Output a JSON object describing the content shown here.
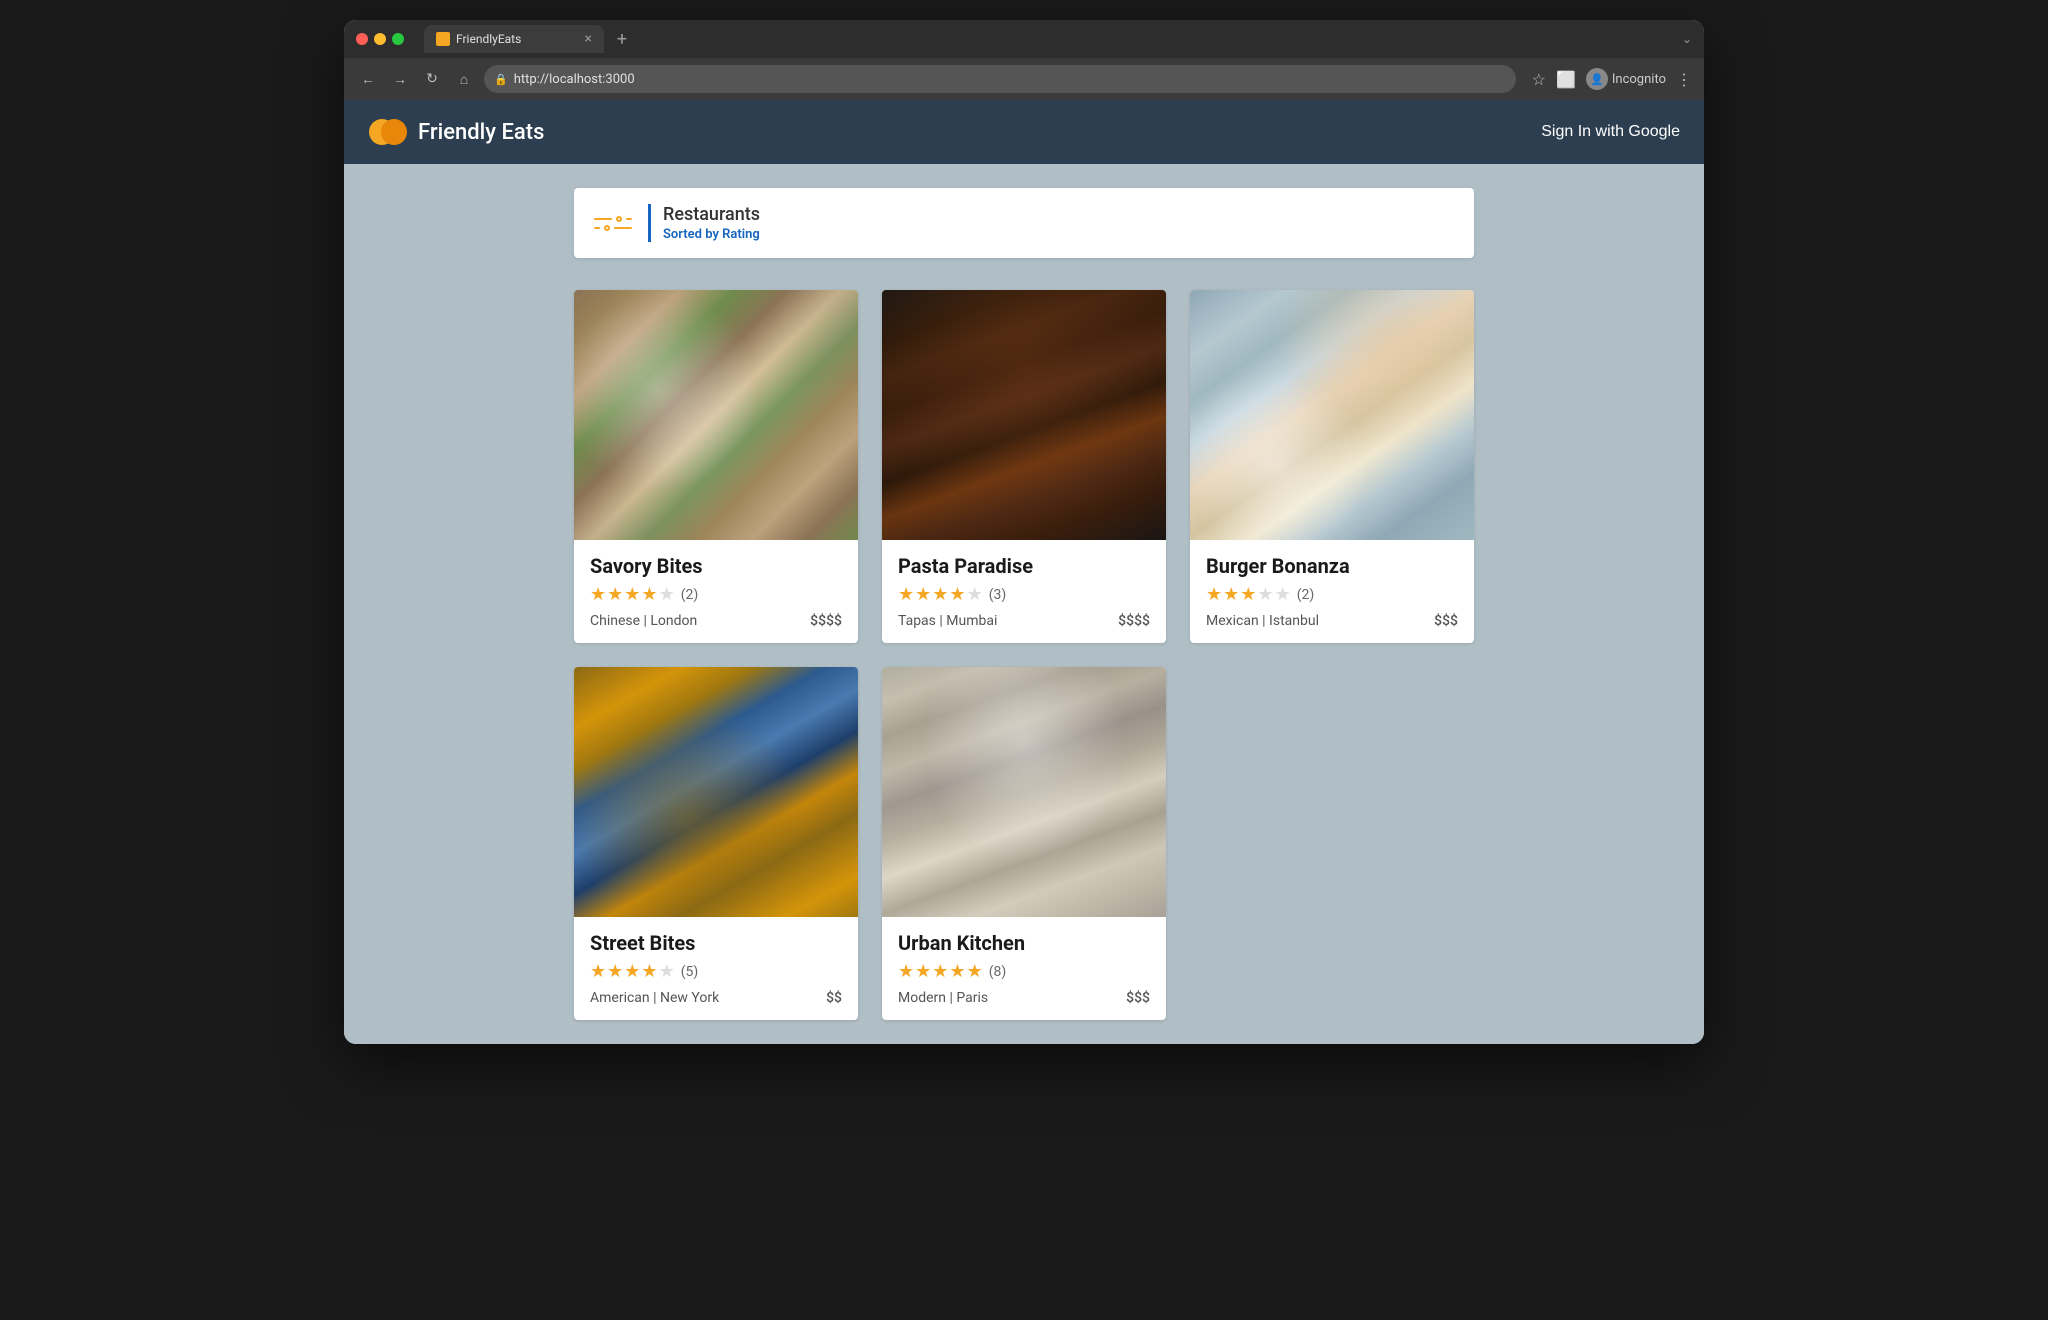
{
  "browser": {
    "tab_title": "FriendlyEats",
    "url": "http://localhost:3000",
    "incognito_label": "Incognito",
    "new_tab_symbol": "+",
    "chevron": "⌄"
  },
  "app": {
    "title": "Friendly Eats",
    "sign_in_label": "Sign In with Google"
  },
  "restaurants_section": {
    "heading": "Restaurants",
    "sort_label": "Sorted by Rating"
  },
  "restaurants": [
    {
      "name": "Savory Bites",
      "rating": 3.5,
      "review_count": 2,
      "cuisine": "Chinese",
      "location": "London",
      "price": "$$$$",
      "image_class": "img-noodles"
    },
    {
      "name": "Pasta Paradise",
      "rating": 3.5,
      "review_count": 3,
      "cuisine": "Tapas",
      "location": "Mumbai",
      "price": "$$$$",
      "image_class": "img-meat"
    },
    {
      "name": "Burger Bonanza",
      "rating": 3.0,
      "review_count": 2,
      "cuisine": "Mexican",
      "location": "Istanbul",
      "price": "$$$",
      "image_class": "img-table"
    },
    {
      "name": "Street Bites",
      "rating": 4.0,
      "review_count": 5,
      "cuisine": "American",
      "location": "New York",
      "price": "$$",
      "image_class": "img-burger"
    },
    {
      "name": "Urban Kitchen",
      "rating": 4.5,
      "review_count": 8,
      "cuisine": "Modern",
      "location": "Paris",
      "price": "$$$",
      "image_class": "img-kitchen"
    }
  ]
}
